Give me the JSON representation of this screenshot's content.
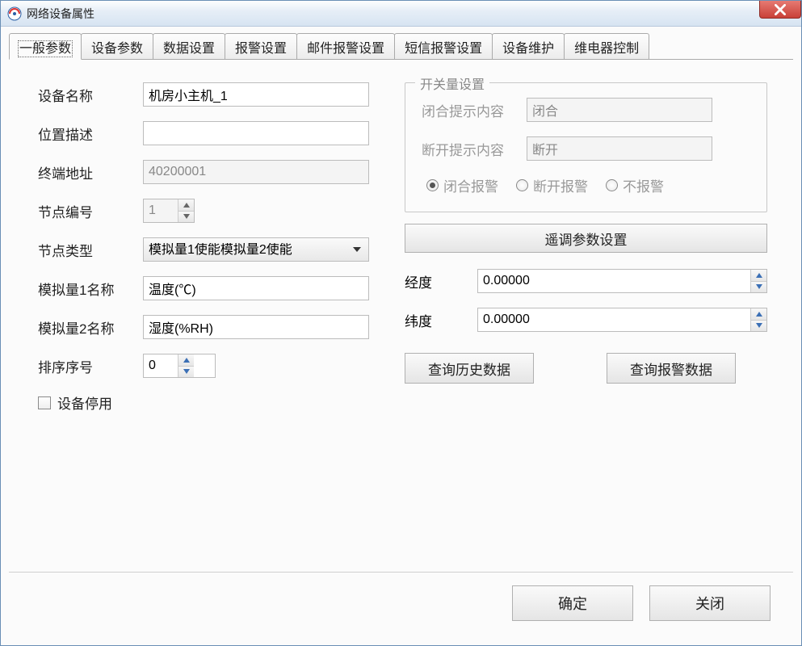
{
  "window": {
    "title": "网络设备属性"
  },
  "tabs": [
    {
      "label": "一般参数",
      "active": true
    },
    {
      "label": "设备参数"
    },
    {
      "label": "数据设置"
    },
    {
      "label": "报警设置"
    },
    {
      "label": "邮件报警设置"
    },
    {
      "label": "短信报警设置"
    },
    {
      "label": "设备维护"
    },
    {
      "label": "维电器控制"
    }
  ],
  "left": {
    "device_name_label": "设备名称",
    "device_name_value": "机房小主机_1",
    "location_label": "位置描述",
    "location_value": "",
    "terminal_addr_label": "终端地址",
    "terminal_addr_value": "40200001",
    "node_no_label": "节点编号",
    "node_no_value": "1",
    "node_type_label": "节点类型",
    "node_type_value": "模拟量1使能模拟量2使能",
    "analog1_label": "模拟量1名称",
    "analog1_value": "温度(℃)",
    "analog2_label": "模拟量2名称",
    "analog2_value": "湿度(%RH)",
    "sort_no_label": "排序序号",
    "sort_no_value": "0",
    "device_disabled_label": "设备停用"
  },
  "right": {
    "group_title": "开关量设置",
    "close_prompt_label": "闭合提示内容",
    "close_prompt_value": "闭合",
    "open_prompt_label": "断开提示内容",
    "open_prompt_value": "断开",
    "radio_close": "闭合报警",
    "radio_open": "断开报警",
    "radio_none": "不报警",
    "remote_btn": "遥调参数设置",
    "lon_label": "经度",
    "lon_value": "0.00000",
    "lat_label": "纬度",
    "lat_value": "0.00000",
    "query_history": "查询历史数据",
    "query_alarm": "查询报警数据"
  },
  "footer": {
    "ok": "确定",
    "close": "关闭"
  }
}
